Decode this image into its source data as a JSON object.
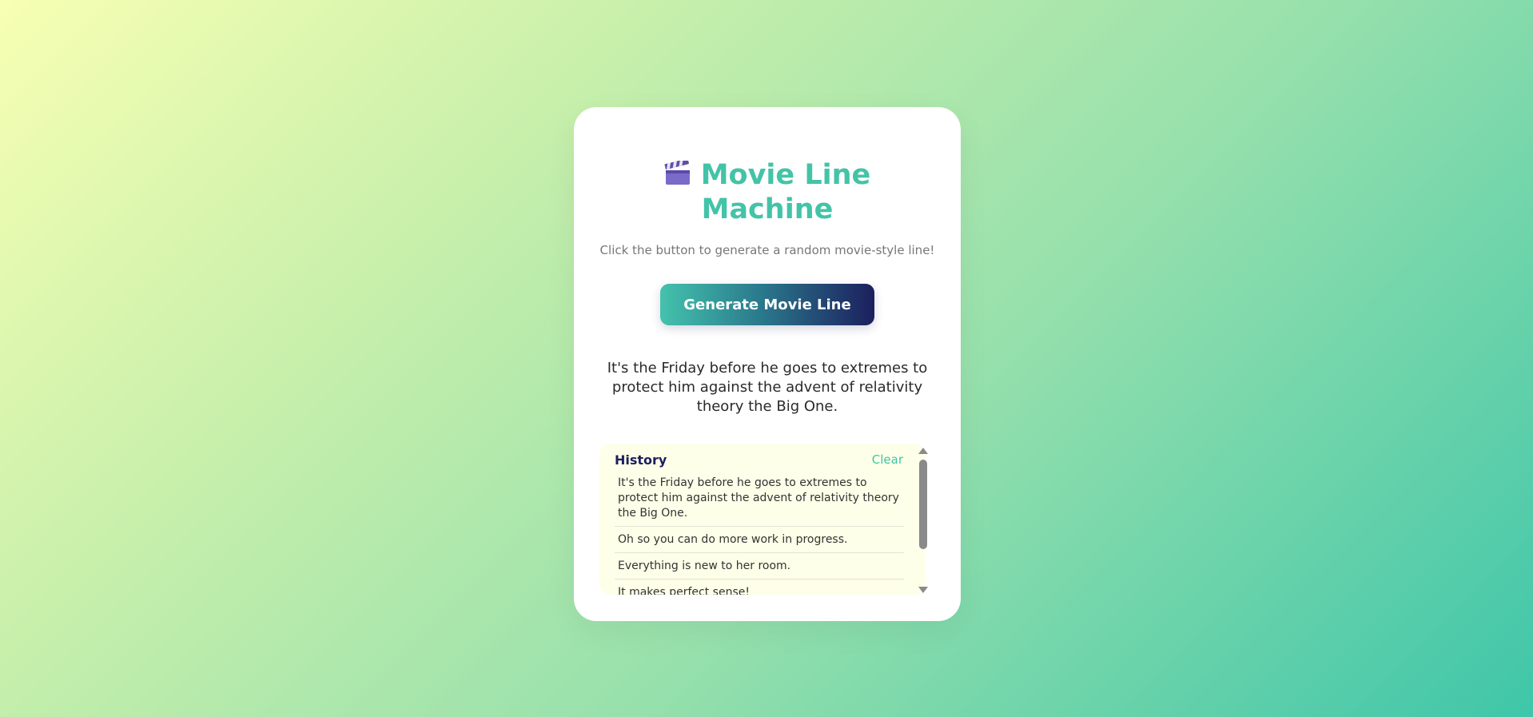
{
  "app": {
    "title_line1": "Movie Line",
    "title_line2": "Machine",
    "title_icon": "clapperboard-icon",
    "subtitle": "Click the button to generate a random movie-style line!",
    "generate_label": "Generate Movie Line",
    "current_line": "It's the Friday before he goes to extremes to protect him against the advent of relativity theory the Big One."
  },
  "history": {
    "title": "History",
    "clear_label": "Clear",
    "items": [
      "It's the Friday before he goes to extremes to protect him against the advent of relativity theory the Big One.",
      "Oh so you can do more work in progress.",
      "Everything is new to her room.",
      "It makes perfect sense!"
    ]
  },
  "colors": {
    "accent": "#43c3a7",
    "navy": "#1c1f5e",
    "history_bg": "#fdffe8"
  }
}
